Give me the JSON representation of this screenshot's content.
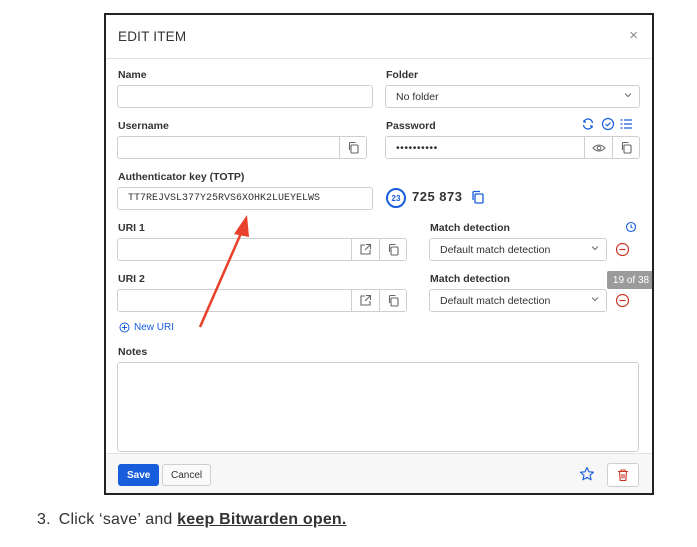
{
  "dialog": {
    "title": "EDIT ITEM",
    "close_glyph": "×",
    "name_label": "Name",
    "name_value": "",
    "folder_label": "Folder",
    "folder_value": "No folder",
    "username_label": "Username",
    "username_value": "",
    "password_label": "Password",
    "password_value": "••••••••••",
    "totp_label": "Authenticator key (TOTP)",
    "totp_key": "TT7REJVSL377Y25RVS6XOHK2LUEYELWS",
    "totp_seconds": "23",
    "totp_code": "725 873",
    "uris": [
      {
        "label": "URI 1",
        "value": "",
        "match_label": "Match detection",
        "match_value": "Default match detection"
      },
      {
        "label": "URI 2",
        "value": "",
        "match_label": "Match detection",
        "match_value": "Default match detection"
      }
    ],
    "new_uri_label": "New URI",
    "notes_label": "Notes",
    "notes_value": "",
    "save_label": "Save",
    "cancel_label": "Cancel"
  },
  "overlay": {
    "timestamp": "19 of 38"
  },
  "caption": {
    "number": "3.",
    "text": "Click ‘save’ and ",
    "emphasis": "keep Bitwarden open."
  },
  "colors": {
    "accent": "#175ddc",
    "danger": "#c83522",
    "arrow": "#e8412c"
  },
  "icons": [
    "close-icon",
    "chevron-down-icon",
    "refresh-icon",
    "check-circle-icon",
    "list-icon",
    "copy-icon",
    "eye-icon",
    "launch-icon",
    "minus-circle-icon",
    "plus-circle-icon",
    "star-icon",
    "trash-icon",
    "help-icon"
  ]
}
